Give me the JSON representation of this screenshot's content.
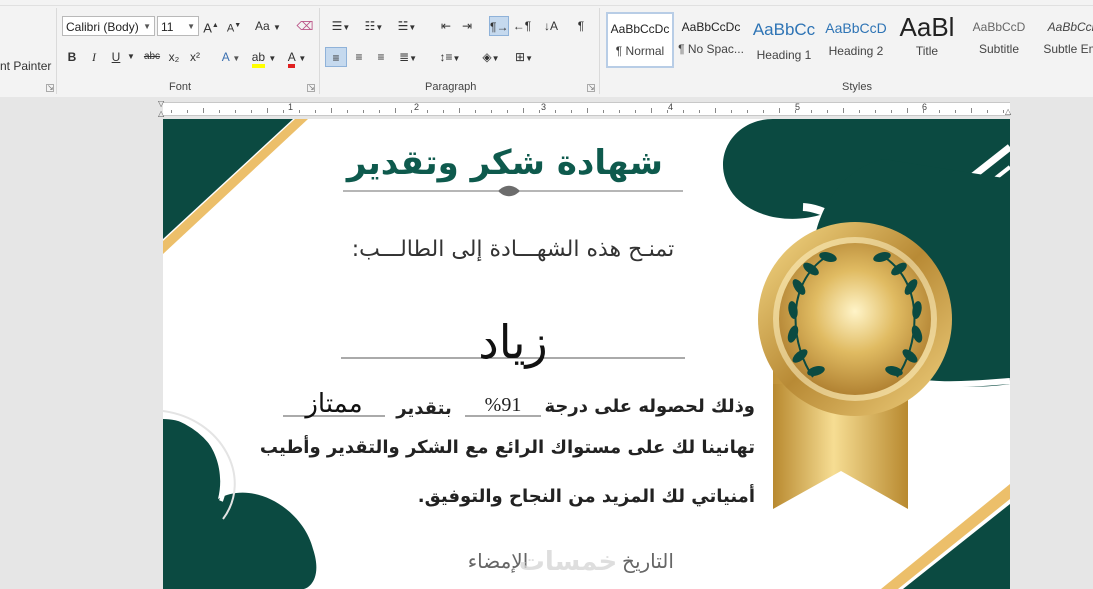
{
  "ribbon": {
    "clipboard": {
      "format_painter_label": "nt Painter"
    },
    "font": {
      "group_label": "Font",
      "font_name": "Calibri (Body)",
      "font_size": "11",
      "grow_font": "A",
      "shrink_font": "A",
      "change_case": "Aa",
      "bold": "B",
      "italic": "I",
      "underline": "U",
      "strikethrough": "abc",
      "subscript": "x₂",
      "superscript": "x²"
    },
    "paragraph": {
      "group_label": "Paragraph",
      "show_marks": "¶"
    },
    "styles": {
      "group_label": "Styles",
      "items": [
        {
          "preview": "AaBbCcDc",
          "name": "¶ Normal"
        },
        {
          "preview": "AaBbCcDc",
          "name": "¶ No Spac..."
        },
        {
          "preview": "AaBbCc",
          "name": "Heading 1"
        },
        {
          "preview": "AaBbCcD",
          "name": "Heading 2"
        },
        {
          "preview": "AaBl",
          "name": "Title"
        },
        {
          "preview": "AaBbCcD",
          "name": "Subtitle"
        },
        {
          "preview": "AaBbCcl",
          "name": "Subtle Em"
        }
      ]
    }
  },
  "ruler": {
    "numbers": [
      "1",
      "1",
      "2",
      "3",
      "4",
      "5",
      "6"
    ]
  },
  "certificate": {
    "title": "شهادة شكر وتقدير",
    "intro": "تمنـح هذه الشهـــادة إلى الطالـــب:",
    "student_name": "زياد",
    "line1_start": "وذلك لحصوله على درجة",
    "score": "%91",
    "grade_label": "بتقدير",
    "grade": "ممتاز",
    "line2": "تهانينا لك على مستواك الرائع مع الشكر والتقدير وأطيب",
    "line3": "أمنياتي لك المزيد من النجاح والتوفيق.",
    "date_label": "التاريخ",
    "signature_label": "الإمضاء",
    "watermark": "خمسات"
  },
  "colors": {
    "dark_green": "#0b4a41",
    "gold": "#e9be6a",
    "text_green": "#0e5a4d"
  }
}
